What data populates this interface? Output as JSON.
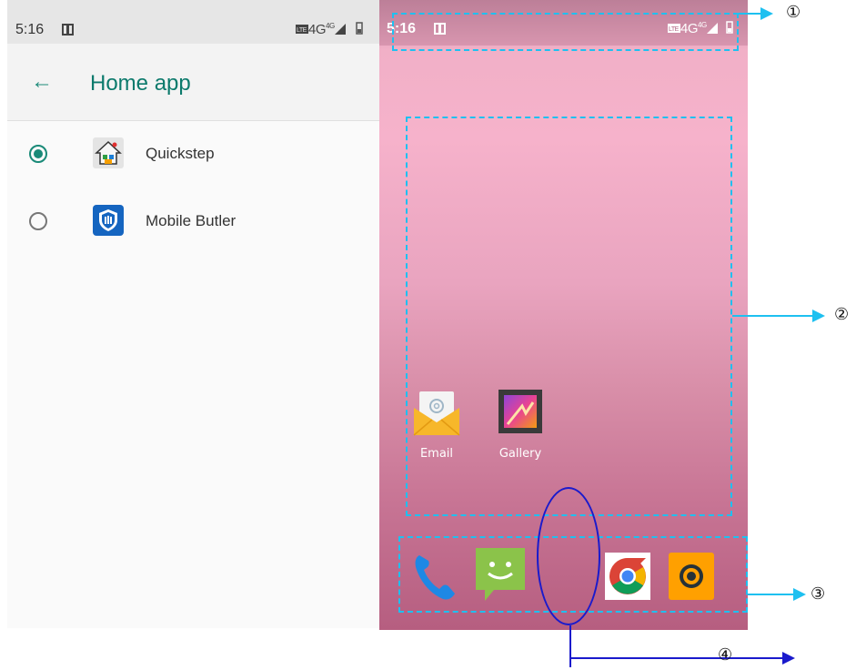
{
  "left": {
    "status": {
      "time": "5:16",
      "right_text": "4G",
      "lte_text": "LTE",
      "sup_text": "4G"
    },
    "toolbar": {
      "back": "←",
      "title": "Home app"
    },
    "options": [
      {
        "label": "Quickstep",
        "selected": true,
        "icon": "quickstep-house-icon"
      },
      {
        "label": "Mobile Butler",
        "selected": false,
        "icon": "mobile-butler-shield-icon"
      }
    ]
  },
  "home": {
    "status": {
      "time": "5:16",
      "right_text": "4G",
      "lte_text": "LTE",
      "sup_text": "4G"
    },
    "apps": [
      {
        "label": "Email",
        "icon": "email-envelope-icon"
      },
      {
        "label": "Gallery",
        "icon": "gallery-icon"
      }
    ],
    "dock": [
      {
        "name": "phone-icon"
      },
      {
        "name": "messaging-icon"
      },
      {
        "name": "chrome-icon"
      },
      {
        "name": "camera-icon"
      }
    ]
  },
  "annotations": {
    "labels": [
      "①",
      "②",
      "③",
      "④"
    ],
    "dash_color": "#1ec0f0",
    "oval_color": "#1a1acc"
  }
}
